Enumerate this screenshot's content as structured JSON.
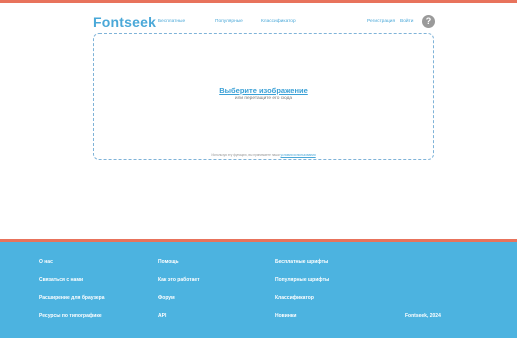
{
  "header": {
    "logo": "Fontseek",
    "nav": [
      "Бесплатные",
      "Популярные",
      "Классификатор"
    ],
    "register": "Регистрация",
    "login": "Войти",
    "help": "?"
  },
  "upload": {
    "title": "Выберите изображение",
    "subtitle": "или перетащите его сюда",
    "terms_prefix": "Используя эту функцию, вы принимаете наши",
    "terms_link": "условия использования"
  },
  "footer": {
    "col1": [
      "О нас",
      "Связаться с нами",
      "Расширение для браузера",
      "Ресурсы по типографике"
    ],
    "col2": [
      "Помощь",
      "Как это работает",
      "Форум",
      "API"
    ],
    "col3": [
      "Бесплатные шрифты",
      "Популярные шрифты",
      "Классификатор",
      "Новинки"
    ],
    "copyright": "Fontseek, 2024"
  },
  "colors": {
    "accent": "#4aa8d8",
    "stripe": "#e8735c",
    "footer_bg": "#4cb3e0"
  }
}
